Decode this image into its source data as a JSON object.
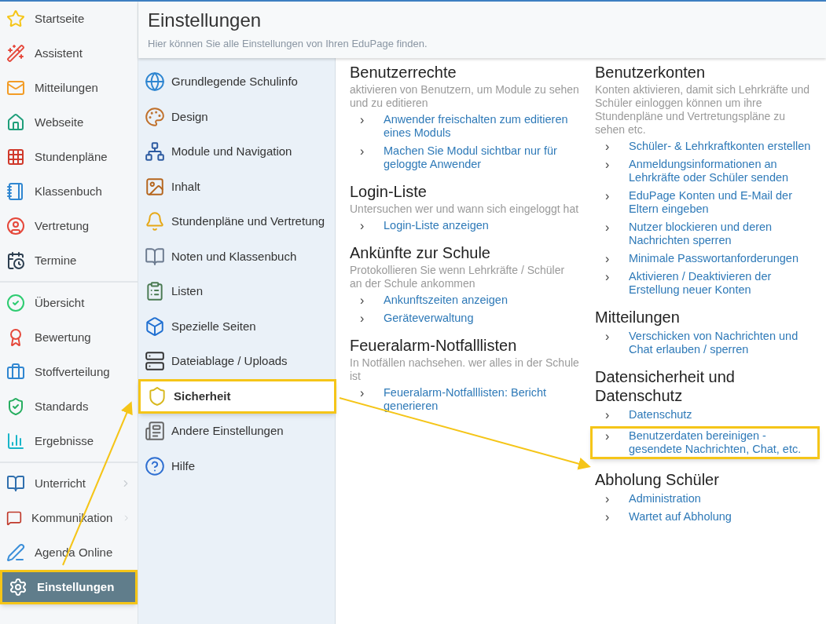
{
  "sidebar": {
    "groups": [
      {
        "items": [
          {
            "label": "Startseite",
            "selected": false,
            "highlighted": false,
            "submenu": false
          },
          {
            "label": "Assistent",
            "selected": false,
            "highlighted": false,
            "submenu": false
          },
          {
            "label": "Mitteilungen",
            "selected": false,
            "highlighted": false,
            "submenu": false
          },
          {
            "label": "Webseite",
            "selected": false,
            "highlighted": false,
            "submenu": false
          },
          {
            "label": "Stundenpläne",
            "selected": false,
            "highlighted": false,
            "submenu": false
          },
          {
            "label": "Klassenbuch",
            "selected": false,
            "highlighted": false,
            "submenu": false
          },
          {
            "label": "Vertretung",
            "selected": false,
            "highlighted": false,
            "submenu": false
          },
          {
            "label": "Termine",
            "selected": false,
            "highlighted": false,
            "submenu": false
          }
        ]
      },
      {
        "items": [
          {
            "label": "Übersicht",
            "selected": false,
            "highlighted": false,
            "submenu": false
          },
          {
            "label": "Bewertung",
            "selected": false,
            "highlighted": false,
            "submenu": false
          },
          {
            "label": "Stoffverteilung",
            "selected": false,
            "highlighted": false,
            "submenu": false
          },
          {
            "label": "Standards",
            "selected": false,
            "highlighted": false,
            "submenu": false
          },
          {
            "label": "Ergebnisse",
            "selected": false,
            "highlighted": false,
            "submenu": false
          }
        ]
      },
      {
        "items": [
          {
            "label": "Unterricht",
            "selected": false,
            "highlighted": false,
            "submenu": true
          },
          {
            "label": "Kommunikation",
            "selected": false,
            "highlighted": false,
            "submenu": true
          },
          {
            "label": "Agenda Online",
            "selected": false,
            "highlighted": false,
            "submenu": false
          },
          {
            "label": "Einstellungen",
            "selected": true,
            "highlighted": true,
            "submenu": false
          }
        ]
      }
    ]
  },
  "header": {
    "title": "Einstellungen",
    "subtitle": "Hier können Sie alle Einstellungen von Ihren EduPage finden."
  },
  "settings_menu": [
    {
      "label": "Grundlegende Schulinfo",
      "selected": false,
      "highlighted": false
    },
    {
      "label": "Design",
      "selected": false,
      "highlighted": false
    },
    {
      "label": "Module und Navigation",
      "selected": false,
      "highlighted": false
    },
    {
      "label": "Inhalt",
      "selected": false,
      "highlighted": false
    },
    {
      "label": "Stundenpläne und Vertretung",
      "selected": false,
      "highlighted": false
    },
    {
      "label": "Noten und Klassenbuch",
      "selected": false,
      "highlighted": false
    },
    {
      "label": "Listen",
      "selected": false,
      "highlighted": false
    },
    {
      "label": "Spezielle Seiten",
      "selected": false,
      "highlighted": false
    },
    {
      "label": "Dateiablage / Uploads",
      "selected": false,
      "highlighted": false
    },
    {
      "label": "Sicherheit",
      "selected": true,
      "highlighted": true
    },
    {
      "label": "Andere Einstellungen",
      "selected": false,
      "highlighted": false
    },
    {
      "label": "Hilfe",
      "selected": false,
      "highlighted": false
    }
  ],
  "columns": [
    {
      "sections": [
        {
          "title": "Benutzerrechte",
          "description": "aktivieren von Benutzern, um Module zu sehen und zu editieren",
          "links": [
            {
              "chevron": "›",
              "label": "Anwender freischalten zum editieren eines Moduls",
              "highlighted": false
            },
            {
              "chevron": "›",
              "label": "Machen Sie Modul sichtbar nur für geloggte Anwender",
              "highlighted": false
            }
          ]
        },
        {
          "title": "Login-Liste",
          "description": "Untersuchen wer und wann sich eingeloggt hat",
          "links": [
            {
              "chevron": "›",
              "label": "Login-Liste anzeigen",
              "highlighted": false
            }
          ]
        },
        {
          "title": "Ankünfte zur Schule",
          "description": "Protokollieren Sie wenn Lehrkräfte / Schüler an der Schule ankommen",
          "links": [
            {
              "chevron": "›",
              "label": "Ankunftszeiten anzeigen",
              "highlighted": false
            },
            {
              "chevron": "›",
              "label": "Geräteverwaltung",
              "highlighted": false
            }
          ]
        },
        {
          "title": "Feueralarm-Notfalllisten",
          "description": "In Notfällen nachsehen. wer alles in der Schule ist",
          "links": [
            {
              "chevron": "›",
              "label": "Feueralarm-Notfalllisten: Bericht generieren",
              "highlighted": false
            }
          ]
        }
      ]
    },
    {
      "sections": [
        {
          "title": "Benutzerkonten",
          "description": "Konten aktivieren, damit sich Lehrkräfte und Schüler einloggen können um ihre Stundenpläne und Vertretungspläne zu sehen etc.",
          "links": [
            {
              "chevron": "›",
              "label": "Schüler- & Lehrkraftkonten erstellen",
              "highlighted": false
            },
            {
              "chevron": "›",
              "label": "Anmeldungsinformationen an Lehrkräfte oder Schüler senden",
              "highlighted": false
            },
            {
              "chevron": "›",
              "label": "EduPage Konten und E-Mail der Eltern eingeben",
              "highlighted": false
            },
            {
              "chevron": "›",
              "label": "Nutzer blockieren und deren Nachrichten sperren",
              "highlighted": false
            },
            {
              "chevron": "›",
              "label": "Minimale Passwortanforderungen",
              "highlighted": false
            },
            {
              "chevron": "›",
              "label": "Aktivieren / Deaktivieren der Erstellung neuer Konten",
              "highlighted": false
            }
          ]
        },
        {
          "title": "Mitteilungen",
          "links": [
            {
              "chevron": "›",
              "label": "Verschicken von Nachrichten und Chat erlauben / sperren",
              "highlighted": false
            }
          ]
        },
        {
          "title": "Datensicherheit und Datenschutz",
          "links": [
            {
              "chevron": "›",
              "label": "Datenschutz",
              "highlighted": false
            },
            {
              "chevron": "›",
              "label": "Benutzerdaten bereinigen - gesendete Nachrichten, Chat, etc.",
              "highlighted": true
            }
          ]
        },
        {
          "title": "Abholung Schüler",
          "links": [
            {
              "chevron": "›",
              "label": "Administration",
              "highlighted": false
            },
            {
              "chevron": "›",
              "label": "Wartet auf Abholung",
              "highlighted": false
            }
          ]
        }
      ]
    }
  ]
}
